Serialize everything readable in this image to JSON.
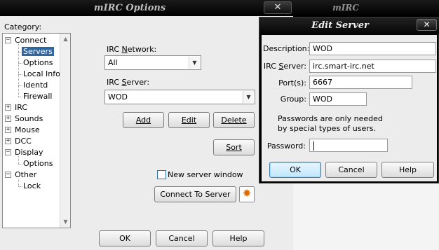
{
  "main_window": {
    "title": "mIRC Options",
    "close_glyph": "✕",
    "category_label": "Category:",
    "tree": [
      {
        "label": "Connect",
        "expander": "−"
      },
      {
        "label": "Servers",
        "selected": true
      },
      {
        "label": "Options"
      },
      {
        "label": "Local Info"
      },
      {
        "label": "Identd"
      },
      {
        "label": "Firewall"
      },
      {
        "label": "IRC",
        "expander": "+"
      },
      {
        "label": "Sounds",
        "expander": "+"
      },
      {
        "label": "Mouse",
        "expander": "+"
      },
      {
        "label": "DCC",
        "expander": "+"
      },
      {
        "label": "Display",
        "expander": "−"
      },
      {
        "label": "Options"
      },
      {
        "label": "Other",
        "expander": "−"
      },
      {
        "label": "Lock"
      }
    ],
    "irc_network_label": "IRC Network:",
    "irc_network_value": "All",
    "irc_server_label": "IRC Server:",
    "irc_server_value": "WOD",
    "add_button": "Add",
    "edit_button": "Edit",
    "delete_button": "Delete",
    "sort_button": "Sort",
    "new_window_label": "New server window",
    "new_window_checked": false,
    "connect_button": "Connect To Server",
    "ok_button": "OK",
    "cancel_button": "Cancel",
    "help_button": "Help"
  },
  "background_window": {
    "title": "mIRC"
  },
  "edit_server": {
    "title": "Edit Server",
    "close_glyph": "✕",
    "description_label": "Description:",
    "description_value": "WOD",
    "server_label": "IRC Server:",
    "server_value": "irc.smart-irc.net",
    "ports_label": "Port(s):",
    "ports_value": "6667",
    "group_label": "Group:",
    "group_value": "WOD",
    "password_note": "Passwords are only needed by special types of users.",
    "password_label": "Password:",
    "password_value": "",
    "ok_button": "OK",
    "cancel_button": "Cancel",
    "help_button": "Help"
  },
  "icons": {
    "dropdown": "chevron-down-icon",
    "fire": "fire-icon",
    "close": "close-icon"
  },
  "colors": {
    "selection": "#31669e",
    "titlebar": "#000000",
    "focus_border": "#3c7fb1"
  }
}
